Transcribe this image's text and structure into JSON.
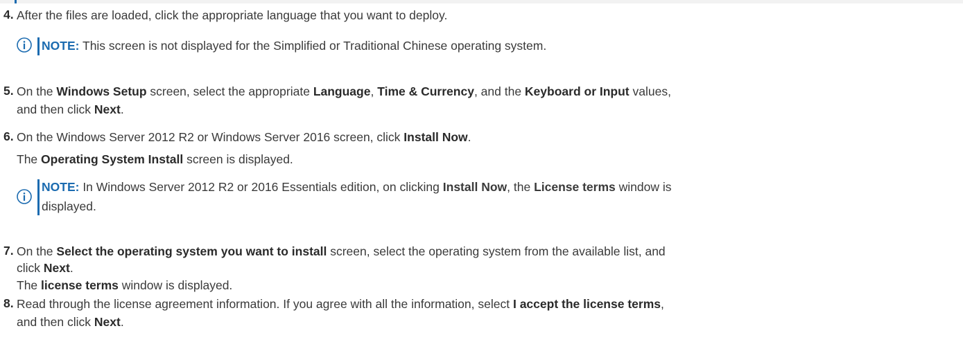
{
  "step4": {
    "number": "4.",
    "text": "After the files are loaded, click the appropriate language that you want to deploy.",
    "note": {
      "label": "NOTE:",
      "text": " This screen is not displayed for the Simplified or Traditional Chinese operating system."
    }
  },
  "step5": {
    "number": "5.",
    "t1": "On the ",
    "b1": "Windows Setup",
    "t2": " screen, select the appropriate ",
    "b2": "Language",
    "t3": ", ",
    "b3": "Time & Currency",
    "t4": ", and the ",
    "b4": "Keyboard or Input",
    "t5": " values,",
    "t6": "and then click ",
    "b5": "Next",
    "t7": "."
  },
  "step6": {
    "number": "6.",
    "t1": "On the Windows Server 2012 R2 or Windows Server 2016 screen, click ",
    "b1": "Install Now",
    "t2": ".",
    "t3": "The ",
    "b2": "Operating System Install",
    "t4": " screen is displayed.",
    "note": {
      "label": "NOTE:",
      "t1": " In Windows Server 2012 R2 or 2016 Essentials edition, on clicking ",
      "b1": "Install Now",
      "t2": ", the ",
      "b2": "License terms",
      "t3": " window is",
      "t4": "displayed."
    }
  },
  "step7": {
    "number": "7.",
    "t1": "On the ",
    "b1": "Select the operating system you want to install",
    "t2": " screen, select the operating system from the available list, and",
    "t3": "click ",
    "b2": "Next",
    "t4": ".",
    "t5": "The ",
    "b3": "license terms",
    "t6": " window is displayed."
  },
  "step8": {
    "number": "8.",
    "t1": "Read through the license agreement information. If you agree with all the information, select ",
    "b1": "I accept the license terms",
    "t2": ",",
    "t3": "and then click ",
    "b2": "Next",
    "t4": "."
  },
  "colors": {
    "accent": "#1b6bb0",
    "text": "#3a3a3a",
    "topband": "#f2f2f2"
  },
  "icons": {
    "note": "info-circle-icon"
  }
}
